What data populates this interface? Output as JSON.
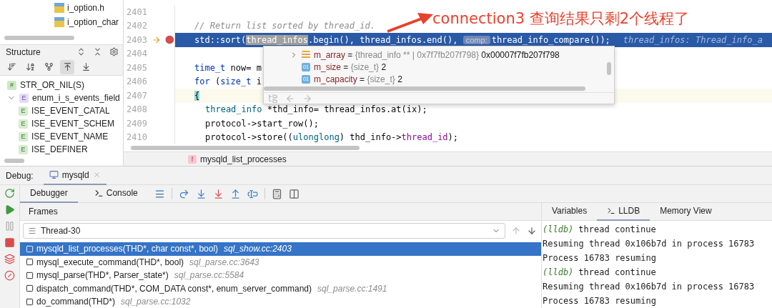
{
  "project_tree": {
    "items": [
      {
        "label": "i_option.h"
      },
      {
        "label": "i_option_char"
      }
    ]
  },
  "structure": {
    "title": "Structure",
    "toolbar": [
      {
        "kind": "sort-visibility",
        "selected": false
      },
      {
        "kind": "sort-alpha",
        "selected": false
      },
      {
        "kind": "fields",
        "selected": false
      },
      {
        "kind": "expand-from",
        "selected": true
      },
      {
        "kind": "collapse-to",
        "selected": false
      }
    ],
    "items": [
      {
        "label": "STR_OR_NIL(S)",
        "kind": "macro",
        "badge": "#"
      },
      {
        "label": "enum_i_s_events_field",
        "kind": "enum",
        "badge": "E",
        "expanded": true,
        "children": [
          {
            "label": "ISE_EVENT_CATAL",
            "kind": "constant",
            "badge": "E"
          },
          {
            "label": "ISE_EVENT_SCHEM",
            "kind": "constant",
            "badge": "E"
          },
          {
            "label": "ISE_EVENT_NAME",
            "kind": "constant",
            "badge": "E"
          },
          {
            "label": "ISE_DEFINER",
            "kind": "constant",
            "badge": "E"
          }
        ]
      }
    ]
  },
  "editor": {
    "lines": [
      {
        "number": "2401"
      },
      {
        "number": "2402",
        "tokens": [
          {
            "text": "// Return list sorted by thread_id.",
            "kind": "comment"
          }
        ]
      },
      {
        "number": "2403",
        "execution": true,
        "breakpoint": true,
        "highlighted": true,
        "tokens": [
          {
            "text": "std::sort(",
            "kind": "plain"
          },
          {
            "text": "thread_infos",
            "kind": "match"
          },
          {
            "text": ".begin(), thread_infos.end(), ",
            "kind": "plain"
          },
          {
            "text": "comp:",
            "kind": "inlay"
          },
          {
            "text": "thread_info_compare());",
            "kind": "plain"
          },
          {
            "text": "thread_infos: Thread_info_a",
            "kind": "hint"
          }
        ]
      },
      {
        "number": "2404"
      },
      {
        "number": "2405",
        "tokens": [
          {
            "text": "time_t",
            "kind": "keyword"
          },
          {
            "text": " now= m",
            "kind": "plain"
          }
        ]
      },
      {
        "number": "2406",
        "tokens": [
          {
            "text": "for",
            "kind": "keyword"
          },
          {
            "text": " (",
            "kind": "plain"
          },
          {
            "text": "size_t",
            "kind": "keyword"
          },
          {
            "text": " i",
            "kind": "plain"
          }
        ]
      },
      {
        "number": "2407",
        "caret": true,
        "tokens": [
          {
            "text": "{",
            "kind": "brace"
          }
        ]
      },
      {
        "number": "2408",
        "indented": true,
        "tokens": [
          {
            "text": "thread_info",
            "kind": "type"
          },
          {
            "text": " *thd_info= thread_infos.at(ix);",
            "kind": "plain"
          }
        ]
      },
      {
        "number": "2409",
        "indented": true,
        "tokens": [
          {
            "text": "protocol->start_row();",
            "kind": "plain"
          }
        ]
      },
      {
        "number": "2410",
        "indented": true,
        "tokens": [
          {
            "text": "protocol->store((",
            "kind": "plain"
          },
          {
            "text": "ulonglong",
            "kind": "type"
          },
          {
            "text": ") thd_info->",
            "kind": "plain"
          },
          {
            "text": "thread_id",
            "kind": "field"
          },
          {
            "text": ");",
            "kind": "plain"
          }
        ]
      }
    ],
    "breadcrumb_badge": "f",
    "breadcrumb": "mysqld_list_processes"
  },
  "popup": {
    "entries": [
      {
        "name": "m_array",
        "kind": "array",
        "expandable": true,
        "operator": "=",
        "type": "{thread_info ** | 0x7f7fb207f798}",
        "value": "0x00007f7fb207f798"
      },
      {
        "name": "m_size",
        "kind": "field",
        "badge": "01",
        "expandable": false,
        "operator": "=",
        "type": "{size_t}",
        "value": "2"
      },
      {
        "name": "m_capacity",
        "kind": "field",
        "badge": "01",
        "expandable": false,
        "operator": "=",
        "type": "{size_t}",
        "value": "2"
      }
    ]
  },
  "annotation": "connection3 查询结果只剩2个线程了",
  "debug": {
    "title": "Debug:",
    "session_tab": "mysqld",
    "tabs": [
      {
        "label": "Debugger",
        "selected": true
      },
      {
        "label": "Console",
        "selected": false
      }
    ],
    "frames_title": "Frames",
    "thread": "Thread-30",
    "frames": [
      {
        "function": "mysqld_list_processes(THD*, char const*, bool)",
        "location": "sql_show.cc:2403",
        "selected": true
      },
      {
        "function": "mysql_execute_command(THD*, bool)",
        "location": "sql_parse.cc:3643",
        "selected": false
      },
      {
        "function": "mysql_parse(THD*, Parser_state*)",
        "location": "sql_parse.cc:5584",
        "selected": false
      },
      {
        "function": "dispatch_command(THD*, COM_DATA const*, enum_server_command)",
        "location": "sql_parse.cc:1491",
        "selected": false
      },
      {
        "function": "do_command(THD*)",
        "location": "sql_parse.cc:1032",
        "selected": false
      }
    ],
    "right_tabs": [
      {
        "label": "Variables",
        "selected": false
      },
      {
        "label": "LLDB",
        "selected": true
      },
      {
        "label": "Memory View",
        "selected": false
      }
    ],
    "console": [
      {
        "prompt": "(lldb)",
        "text": "thread continue"
      },
      {
        "text": "Resuming thread 0x106b7d in process 16783"
      },
      {
        "text": "Process 16783 resuming"
      },
      {
        "prompt": "(lldb)",
        "text": "thread continue"
      },
      {
        "text": "Resuming thread 0x106b7d in process 16783"
      },
      {
        "text": "Process 16783 resuming"
      }
    ]
  }
}
